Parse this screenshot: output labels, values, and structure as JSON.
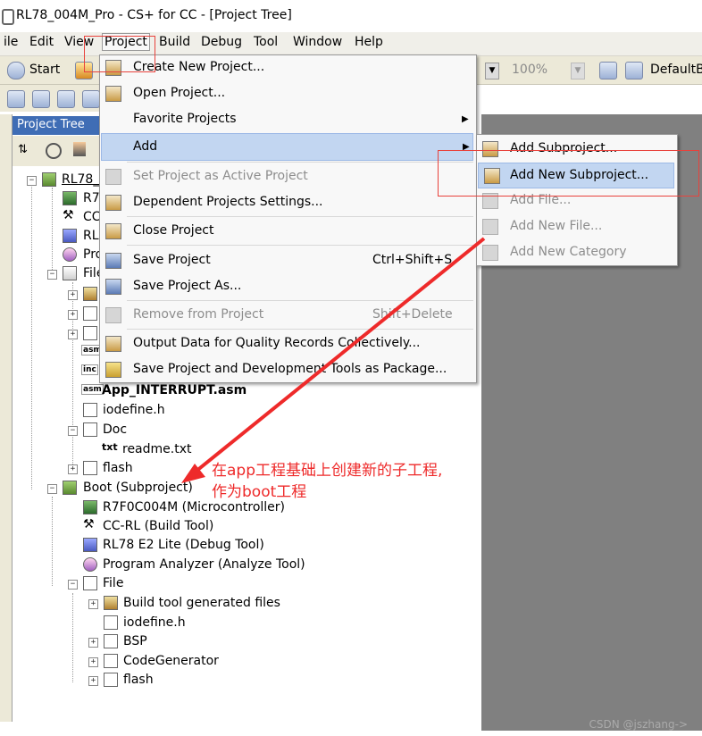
{
  "window": {
    "title": "RL78_004M_Pro - CS+ for CC - [Project Tree]"
  },
  "menubar": [
    "ile",
    "Edit",
    "View",
    "Project",
    "Build",
    "Debug",
    "Tool",
    "Window",
    "Help"
  ],
  "toolbar": {
    "start_label": "Start",
    "zoom": "100%",
    "default_label": "DefaultB"
  },
  "tree_pane": {
    "header": "Project Tree"
  },
  "tree": {
    "app_root_partial": "RL78_",
    "app_items_partial": [
      "R7",
      "CC",
      "RL",
      "Pro",
      "File"
    ],
    "app_interrupt": "App_INTERRUPT.asm",
    "iodefine_app": "iodefine.h",
    "doc": "Doc",
    "readme": "readme.txt",
    "flash_app": "flash",
    "boot": "Boot (Subproject)",
    "boot_mcu": "R7F0C004M (Microcontroller)",
    "boot_build": "CC-RL (Build Tool)",
    "boot_debug": "RL78 E2 Lite (Debug Tool)",
    "boot_analyzer": "Program Analyzer (Analyze Tool)",
    "boot_file": "File",
    "boot_build_files": "Build tool generated files",
    "boot_iodefine": "iodefine.h",
    "boot_bsp": "BSP",
    "boot_codegen": "CodeGenerator",
    "boot_flash": "flash",
    "small_labels": [
      "asm",
      "inc",
      "asm",
      "txt"
    ]
  },
  "project_menu": {
    "items": [
      {
        "label": "Create New Project...",
        "enabled": true
      },
      {
        "label": "Open Project...",
        "enabled": true
      },
      {
        "label": "Favorite Projects",
        "enabled": true,
        "submenu": true
      },
      {
        "label": "Add",
        "enabled": true,
        "submenu": true,
        "highlighted": true
      },
      {
        "label": "Set Project as Active Project",
        "enabled": false
      },
      {
        "label": "Dependent Projects Settings...",
        "enabled": true
      },
      {
        "label": "Close Project",
        "enabled": true
      },
      {
        "label": "Save Project",
        "enabled": true,
        "shortcut": "Ctrl+Shift+S"
      },
      {
        "label": "Save Project As...",
        "enabled": true
      },
      {
        "label": "Remove from Project",
        "enabled": false,
        "shortcut": "Shift+Delete"
      },
      {
        "label": "Output Data for Quality Records Collectively...",
        "enabled": true
      },
      {
        "label": "Save Project and Development Tools as Package...",
        "enabled": true
      }
    ]
  },
  "add_submenu": {
    "items": [
      {
        "label": "Add Subproject...",
        "enabled": true
      },
      {
        "label": "Add New Subproject...",
        "enabled": true,
        "highlighted": true
      },
      {
        "label": "Add File...",
        "enabled": false
      },
      {
        "label": "Add New File...",
        "enabled": false
      },
      {
        "label": "Add New Category",
        "enabled": false
      }
    ]
  },
  "annotation": {
    "line1": "在app工程基础上创建新的子工程,",
    "line2": "作为boot工程",
    "color": "#ee2a2a"
  },
  "watermark": "CSDN @jszhang->"
}
